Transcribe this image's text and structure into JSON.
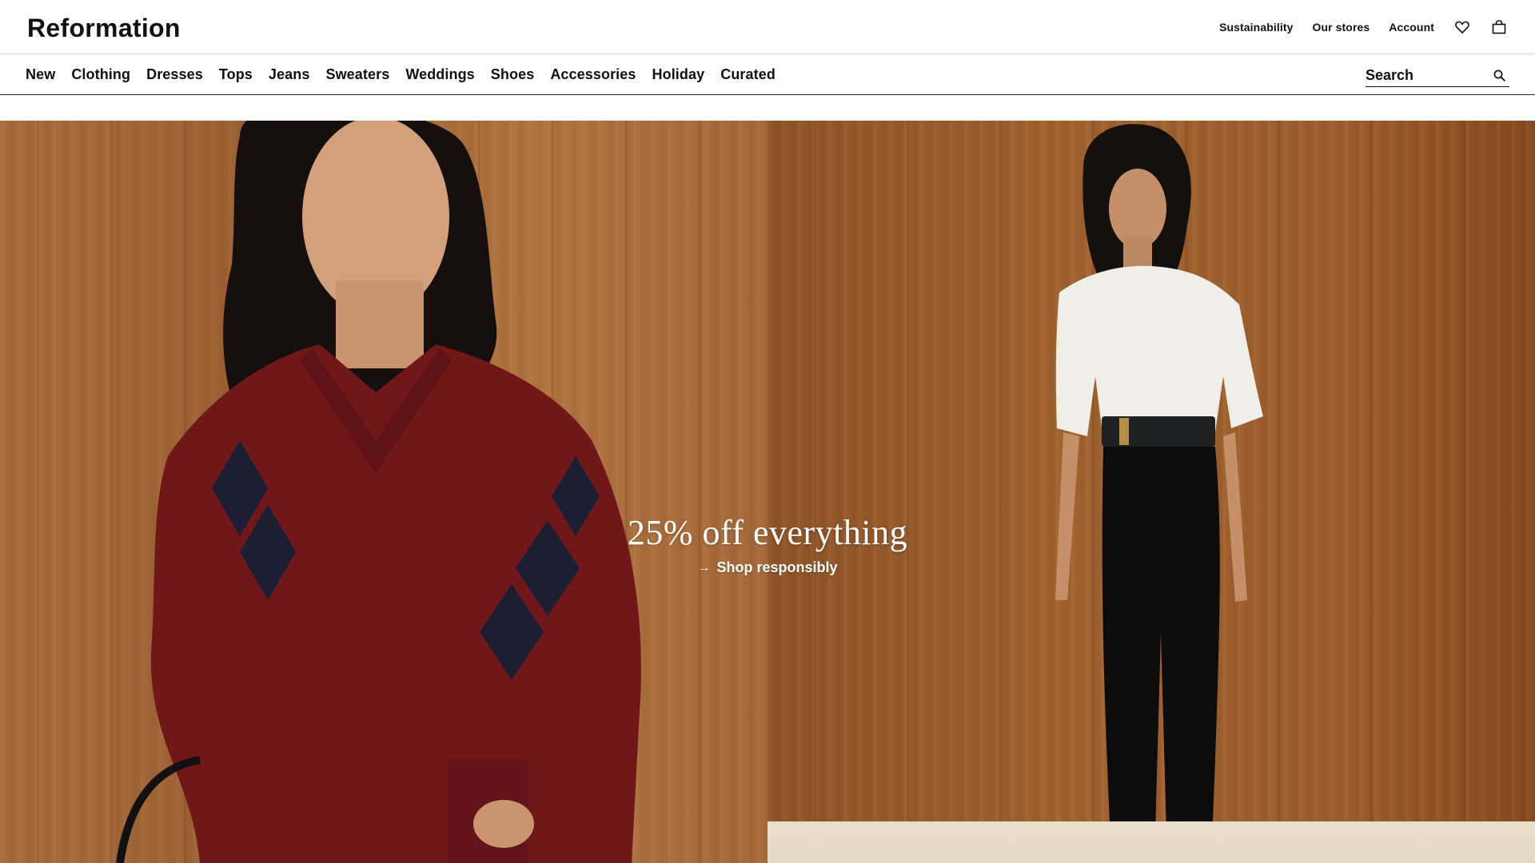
{
  "brand": {
    "logo_text": "Reformation"
  },
  "utility_nav": {
    "links": [
      "Sustainability",
      "Our stores",
      "Account"
    ],
    "icons": [
      "heart-icon",
      "shopping-bag-icon"
    ]
  },
  "main_nav": {
    "items": [
      "New",
      "Clothing",
      "Dresses",
      "Tops",
      "Jeans",
      "Sweaters",
      "Weddings",
      "Shoes",
      "Accessories",
      "Holiday",
      "Curated"
    ]
  },
  "search": {
    "placeholder": "Search",
    "icon": "search-icon"
  },
  "hero": {
    "headline": "25% off everything",
    "cta_label": "Shop responsibly",
    "cta_icon": "arrow-right-icon",
    "text_color": "#ffffff"
  },
  "colors": {
    "text": "#111111",
    "background": "#ffffff",
    "divider": "#222222"
  }
}
